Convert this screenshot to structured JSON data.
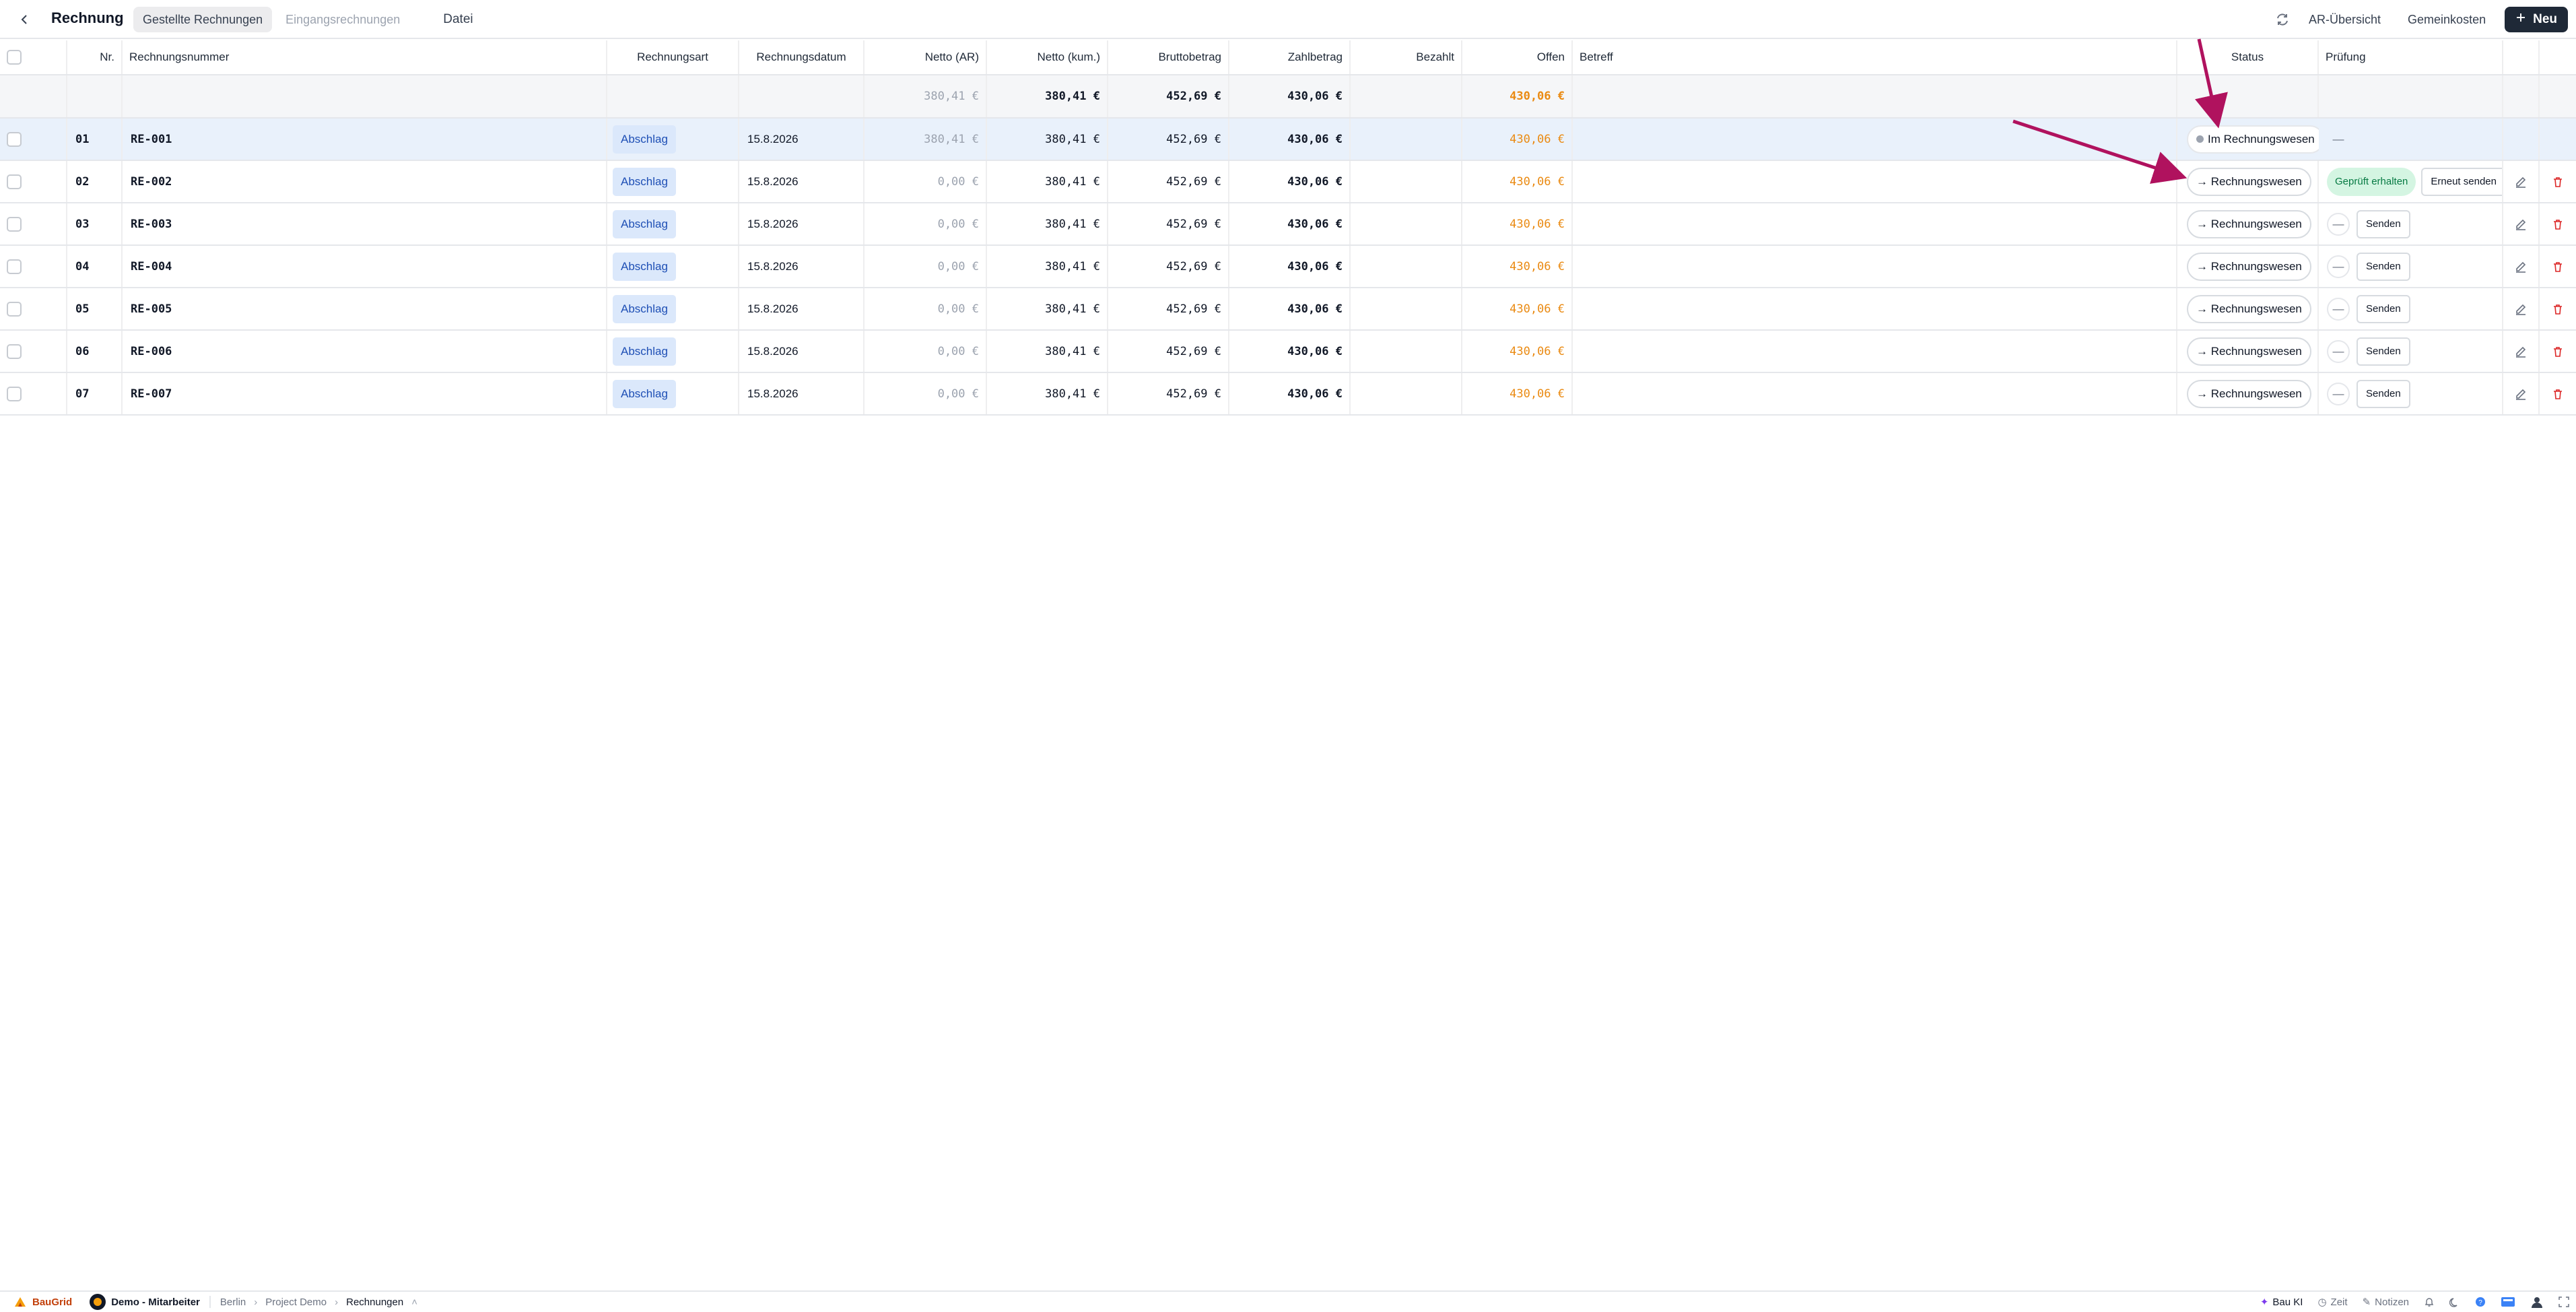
{
  "header": {
    "title": "Rechnung",
    "tabs": [
      {
        "label": "Gestellte Rechnungen",
        "active": true
      },
      {
        "label": "Eingangsrechnungen",
        "active": false
      },
      {
        "label": "Datei",
        "active": false
      }
    ],
    "links": {
      "ar_overview": "AR-Übersicht",
      "overhead": "Gemeinkosten"
    },
    "new_label": "Neu",
    "icons": {
      "back": "chevron-left-icon",
      "refresh": "refresh-icon",
      "new": "plus-icon"
    }
  },
  "table": {
    "columns": {
      "nr": "Nr.",
      "number": "Rechnungsnummer",
      "type": "Rechnungsart",
      "date": "Rechnungsdatum",
      "net_ar": "Netto (AR)",
      "net_cum": "Netto (kum.)",
      "gross": "Bruttobetrag",
      "payment": "Zahlbetrag",
      "paid": "Bezahlt",
      "open": "Offen",
      "subject": "Betreff",
      "status": "Status",
      "review": "Prüfung"
    },
    "summary": {
      "net_ar": "380,41 €",
      "net_cum": "380,41 €",
      "gross": "452,69 €",
      "payment": "430,06 €",
      "open": "430,06 €"
    },
    "rows": [
      {
        "nr": "01",
        "number": "RE-001",
        "type": "Abschlag",
        "date": "15.8.2026",
        "net_ar": "380,41 €",
        "net_cum": "380,41 €",
        "gross": "452,69 €",
        "payment": "430,06 €",
        "open": "430,06 €",
        "status": "Im Rechnungswesen",
        "review": "—"
      },
      {
        "nr": "02",
        "number": "RE-002",
        "type": "Abschlag",
        "date": "15.8.2026",
        "net_ar": "0,00 €",
        "net_cum": "380,41 €",
        "gross": "452,69 €",
        "payment": "430,06 €",
        "open": "430,06 €",
        "status": "→ Rechnungswesen",
        "review": "Geprüft erhalten",
        "resend": "Erneut senden"
      },
      {
        "nr": "03",
        "number": "RE-003",
        "type": "Abschlag",
        "date": "15.8.2026",
        "net_ar": "0,00 €",
        "net_cum": "380,41 €",
        "gross": "452,69 €",
        "payment": "430,06 €",
        "open": "430,06 €",
        "status": "→ Rechnungswesen",
        "review": "—",
        "send": "Senden"
      },
      {
        "nr": "04",
        "number": "RE-004",
        "type": "Abschlag",
        "date": "15.8.2026",
        "net_ar": "0,00 €",
        "net_cum": "380,41 €",
        "gross": "452,69 €",
        "payment": "430,06 €",
        "open": "430,06 €",
        "status": "→ Rechnungswesen",
        "review": "—",
        "send": "Senden"
      },
      {
        "nr": "05",
        "number": "RE-005",
        "type": "Abschlag",
        "date": "15.8.2026",
        "net_ar": "0,00 €",
        "net_cum": "380,41 €",
        "gross": "452,69 €",
        "payment": "430,06 €",
        "open": "430,06 €",
        "status": "→ Rechnungswesen",
        "review": "—",
        "send": "Senden"
      },
      {
        "nr": "06",
        "number": "RE-006",
        "type": "Abschlag",
        "date": "15.8.2026",
        "net_ar": "0,00 €",
        "net_cum": "380,41 €",
        "gross": "452,69 €",
        "payment": "430,06 €",
        "open": "430,06 €",
        "status": "→ Rechnungswesen",
        "review": "—",
        "send": "Senden"
      },
      {
        "nr": "07",
        "number": "RE-007",
        "type": "Abschlag",
        "date": "15.8.2026",
        "net_ar": "0,00 €",
        "net_cum": "380,41 €",
        "gross": "452,69 €",
        "payment": "430,06 €",
        "open": "430,06 €",
        "status": "→ Rechnungswesen",
        "review": "—",
        "send": "Senden"
      }
    ]
  },
  "footer": {
    "brand": "BauGrid",
    "user": "Demo - Mitarbeiter",
    "breadcrumb": [
      "Berlin",
      "Project Demo",
      "Rechnungen"
    ],
    "right": {
      "ai": "Bau KI",
      "time": "Zeit",
      "notes": "Notizen"
    }
  },
  "colors": {
    "accent_orange": "#ea8a12",
    "annotation_arrow": "#b0125e",
    "badge_blue": "#1e4fb5",
    "primary_dark": "#1f2937"
  }
}
